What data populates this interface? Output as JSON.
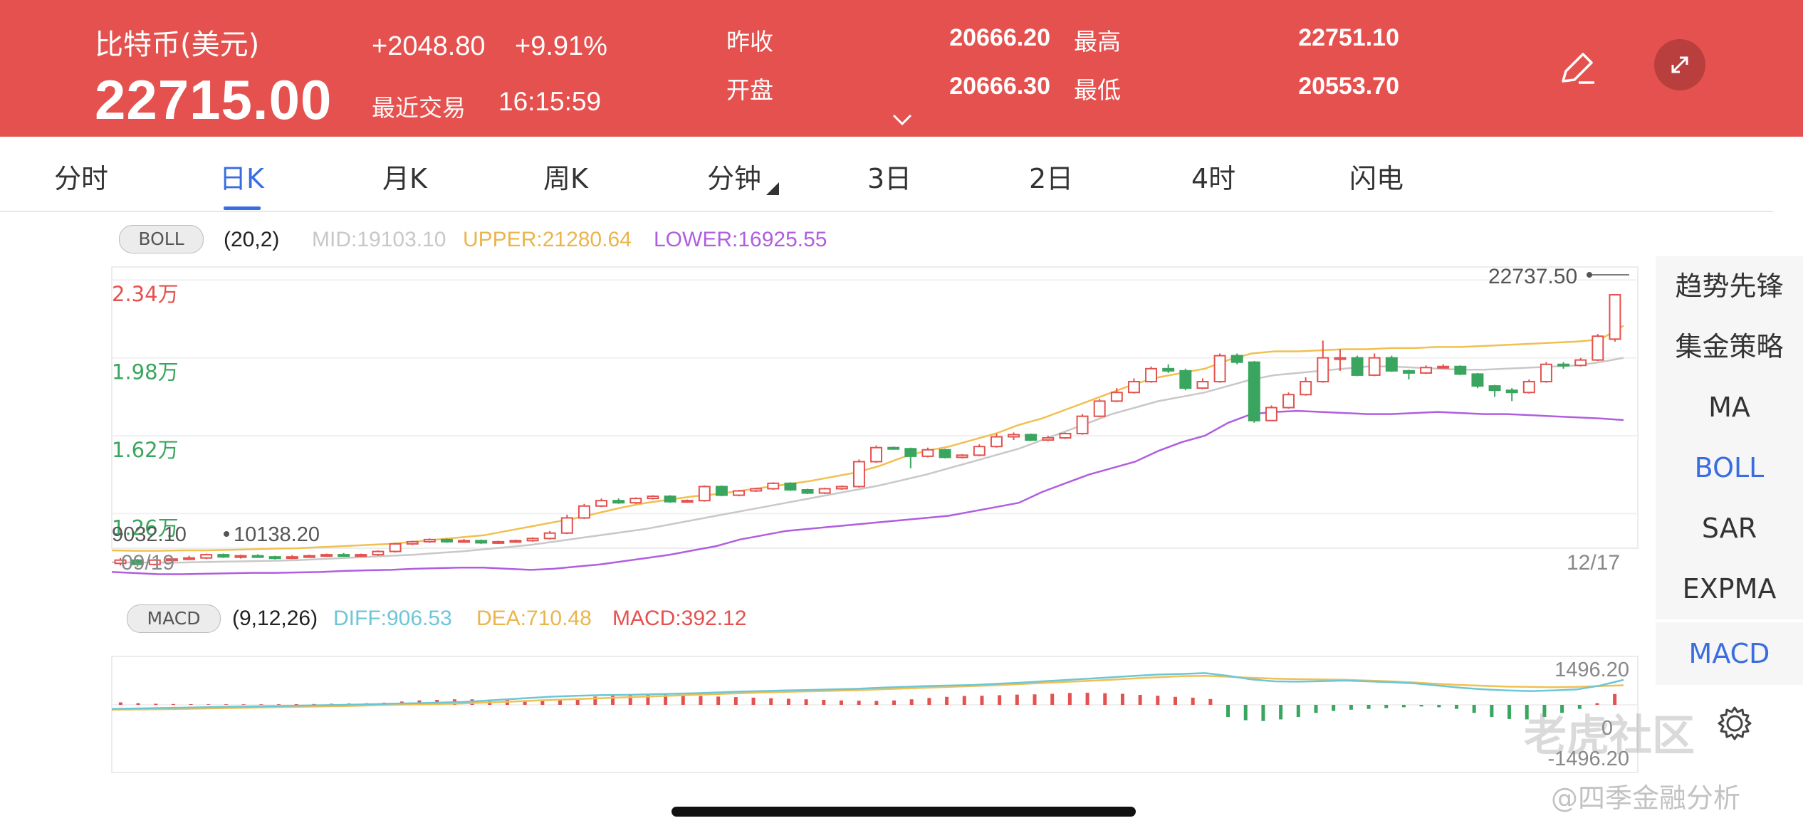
{
  "header": {
    "name": "比特币(美元)",
    "price": "22715.00",
    "change": "+2048.80",
    "change_pct": "+9.91%",
    "last_trade_label": "最近交易",
    "last_trade_time": "16:15:59",
    "prev_close_label": "昨收",
    "prev_close": "20666.20",
    "open_label": "开盘",
    "open": "20666.30",
    "high_label": "最高",
    "high": "22751.10",
    "low_label": "最低",
    "low": "20553.70"
  },
  "tabs": [
    "分时",
    "日K",
    "月K",
    "周K",
    "分钟",
    "3日",
    "2日",
    "4时",
    "闪电"
  ],
  "active_tab": "日K",
  "sidebar": [
    "趋势先锋",
    "集金策略",
    "MA",
    "BOLL",
    "SAR",
    "EXPMA"
  ],
  "sidebar_macd": "MACD",
  "boll": {
    "pill": "BOLL",
    "params": "(20,2)",
    "mid": "MID:19103.10",
    "upper": "UPPER:21280.64",
    "lower": "LOWER:16925.55"
  },
  "macd": {
    "pill": "MACD",
    "params": "(9,12,26)",
    "diff": "DIFF:906.53",
    "dea": "DEA:710.48",
    "macd": "MACD:392.12"
  },
  "watermark": "老虎社区",
  "watermark_sub": "@四季金融分析",
  "colors": {
    "up": "#e4514e",
    "down": "#3aa55e",
    "upper": "#f0c050",
    "lower": "#b05ee0",
    "mid": "#c8c8c8",
    "diff": "#6cc6d6",
    "dea": "#f0c050"
  },
  "chart_data": [
    {
      "type": "candlestick",
      "title": "",
      "x_start": "09/19",
      "x_end": "12/17",
      "y_ticks": [
        "2.34万",
        "1.98万",
        "1.62万",
        "1.26万"
      ],
      "y_tick_values": [
        23400,
        19800,
        16200,
        12600
      ],
      "ylim": [
        11000,
        24000
      ],
      "max_label": "22737.50",
      "min_label": "9032.10",
      "min_label2": "10138.20",
      "candles": [
        [
          10300,
          10450,
          10550,
          10200
        ],
        [
          10450,
          10250,
          10500,
          10150
        ],
        [
          10250,
          10450,
          10500,
          10200
        ],
        [
          10450,
          10500,
          10600,
          10380
        ],
        [
          10500,
          10550,
          10650,
          10450
        ],
        [
          10550,
          10700,
          10750,
          10500
        ],
        [
          10700,
          10600,
          10750,
          10550
        ],
        [
          10600,
          10650,
          10700,
          10520
        ],
        [
          10650,
          10600,
          10720,
          10550
        ],
        [
          10600,
          10550,
          10650,
          10480
        ],
        [
          10550,
          10600,
          10680,
          10500
        ],
        [
          10600,
          10650,
          10700,
          10560
        ],
        [
          10650,
          10700,
          10750,
          10600
        ],
        [
          10700,
          10650,
          10780,
          10620
        ],
        [
          10650,
          10700,
          10750,
          10600
        ],
        [
          10700,
          10850,
          10900,
          10650
        ],
        [
          10850,
          11200,
          11250,
          10800
        ],
        [
          11200,
          11300,
          11350,
          11150
        ],
        [
          11300,
          11400,
          11450,
          11250
        ],
        [
          11400,
          11300,
          11450,
          11250
        ],
        [
          11300,
          11350,
          11420,
          11250
        ],
        [
          11350,
          11250,
          11400,
          11200
        ],
        [
          11250,
          11300,
          11350,
          11200
        ],
        [
          11300,
          11350,
          11400,
          11250
        ],
        [
          11350,
          11450,
          11500,
          11300
        ],
        [
          11450,
          11700,
          11800,
          11400
        ],
        [
          11700,
          12400,
          12550,
          11650
        ],
        [
          12400,
          12950,
          13050,
          12350
        ],
        [
          12950,
          13200,
          13300,
          12900
        ],
        [
          13200,
          13100,
          13300,
          13050
        ],
        [
          13100,
          13300,
          13350,
          13050
        ],
        [
          13300,
          13400,
          13450,
          13250
        ],
        [
          13400,
          13150,
          13450,
          13100
        ],
        [
          13150,
          13200,
          13250,
          13100
        ],
        [
          13200,
          13850,
          13900,
          13150
        ],
        [
          13850,
          13450,
          13900,
          13400
        ],
        [
          13450,
          13650,
          13700,
          13400
        ],
        [
          13650,
          13750,
          13800,
          13600
        ],
        [
          13750,
          14000,
          14050,
          13700
        ],
        [
          14000,
          13700,
          14050,
          13650
        ],
        [
          13700,
          13550,
          13750,
          13500
        ],
        [
          13550,
          13750,
          13800,
          13500
        ],
        [
          13750,
          13850,
          13900,
          13700
        ],
        [
          13850,
          15000,
          15100,
          13800
        ],
        [
          15000,
          15650,
          15750,
          14950
        ],
        [
          15650,
          15600,
          15700,
          15550
        ],
        [
          15600,
          15250,
          15650,
          14700
        ],
        [
          15250,
          15550,
          15650,
          15200
        ],
        [
          15550,
          15200,
          15600,
          15150
        ],
        [
          15200,
          15300,
          15350,
          15150
        ],
        [
          15300,
          15700,
          15800,
          15250
        ],
        [
          15700,
          16150,
          16300,
          15650
        ],
        [
          16150,
          16250,
          16350,
          16000
        ],
        [
          16250,
          16000,
          16300,
          15950
        ],
        [
          16000,
          16100,
          16200,
          15950
        ],
        [
          16100,
          16300,
          16350,
          16050
        ],
        [
          16300,
          17100,
          17200,
          16250
        ],
        [
          17100,
          17800,
          17900,
          17050
        ],
        [
          17800,
          18200,
          18400,
          17750
        ],
        [
          18200,
          18700,
          18850,
          18150
        ],
        [
          18700,
          19300,
          19400,
          18650
        ],
        [
          19300,
          19200,
          19500,
          19100
        ],
        [
          19200,
          18400,
          19300,
          18300
        ],
        [
          18400,
          18700,
          18850,
          18350
        ],
        [
          18700,
          19900,
          20000,
          18650
        ],
        [
          19900,
          19600,
          20000,
          19500
        ],
        [
          19600,
          16900,
          19650,
          16800
        ],
        [
          16900,
          17500,
          17600,
          17300
        ],
        [
          17500,
          18100,
          18200,
          17450
        ],
        [
          18100,
          18700,
          18900,
          18050
        ],
        [
          18700,
          19800,
          20600,
          18650
        ],
        [
          19800,
          19800,
          20200,
          19200
        ],
        [
          19800,
          19000,
          19900,
          18950
        ],
        [
          19000,
          19800,
          20000,
          18950
        ],
        [
          19800,
          19200,
          19900,
          19150
        ],
        [
          19200,
          19100,
          19250,
          18800
        ],
        [
          19100,
          19350,
          19450,
          19050
        ],
        [
          19350,
          19400,
          19500,
          19300
        ],
        [
          19400,
          19050,
          19450,
          19000
        ],
        [
          19050,
          18500,
          19100,
          18400
        ],
        [
          18500,
          18300,
          18550,
          18000
        ],
        [
          18300,
          18200,
          18400,
          17800
        ],
        [
          18200,
          18700,
          18800,
          18150
        ],
        [
          18700,
          19500,
          19600,
          18650
        ],
        [
          19500,
          19450,
          19600,
          19300
        ],
        [
          19450,
          19700,
          19800,
          19400
        ],
        [
          19700,
          20800,
          20900,
          19650
        ],
        [
          20666,
          22715,
          22751,
          20553
        ]
      ],
      "upper": [
        10900,
        10880,
        10880,
        10900,
        10900,
        10920,
        10950,
        10980,
        11000,
        11050,
        11100,
        11150,
        11200,
        11300,
        11400,
        11500,
        11600,
        11800,
        12000,
        12200,
        12400,
        12650,
        12900,
        13100,
        13250,
        13400,
        13500,
        13650,
        13800,
        13950,
        14100,
        14300,
        14500,
        14800,
        15200,
        15500,
        15700,
        16000,
        16300,
        16700,
        17000,
        17400,
        17800,
        18200,
        18600,
        18900,
        19100,
        19300,
        19700,
        20000,
        20100,
        20100,
        20150,
        20200,
        20200,
        20250,
        20250,
        20300,
        20300,
        20350,
        20400,
        20450,
        20500,
        20550,
        20650,
        21280
      ],
      "mid": [
        10350,
        10340,
        10340,
        10340,
        10360,
        10380,
        10400,
        10420,
        10450,
        10500,
        10550,
        10600,
        10650,
        10700,
        10780,
        10850,
        10950,
        11050,
        11150,
        11300,
        11450,
        11600,
        11750,
        11900,
        12100,
        12300,
        12500,
        12700,
        12900,
        13100,
        13300,
        13500,
        13700,
        13900,
        14150,
        14400,
        14700,
        15000,
        15300,
        15600,
        16000,
        16400,
        16800,
        17200,
        17500,
        17800,
        18000,
        18200,
        18500,
        18800,
        19000,
        19100,
        19200,
        19300,
        19400,
        19400,
        19350,
        19300,
        19250,
        19250,
        19300,
        19350,
        19400,
        19450,
        19600,
        19800
      ],
      "lower": [
        9900,
        9850,
        9800,
        9800,
        9820,
        9840,
        9860,
        9860,
        9880,
        9900,
        9950,
        9980,
        10000,
        10050,
        10080,
        10100,
        10100,
        10050,
        10000,
        10050,
        10150,
        10250,
        10400,
        10550,
        10700,
        10900,
        11100,
        11400,
        11600,
        11800,
        11900,
        12000,
        12100,
        12200,
        12300,
        12400,
        12500,
        12700,
        12900,
        13100,
        13600,
        14000,
        14400,
        14700,
        15000,
        15500,
        15900,
        16200,
        16800,
        17200,
        17300,
        17350,
        17300,
        17250,
        17200,
        17200,
        17250,
        17300,
        17250,
        17200,
        17200,
        17150,
        17100,
        17050,
        17000,
        16925
      ]
    },
    {
      "type": "macd",
      "title": "",
      "ylim": [
        -1496.2,
        1496.2
      ],
      "y_ticks": [
        "1496.20",
        "0",
        "-1496.20"
      ],
      "hist": [
        90,
        60,
        40,
        30,
        25,
        20,
        20,
        20,
        20,
        20,
        25,
        30,
        40,
        50,
        60,
        80,
        120,
        160,
        180,
        200,
        200,
        190,
        180,
        170,
        160,
        170,
        220,
        300,
        330,
        360,
        370,
        380,
        350,
        320,
        300,
        280,
        260,
        240,
        220,
        200,
        180,
        160,
        150,
        140,
        160,
        200,
        250,
        290,
        320,
        330,
        350,
        370,
        380,
        400,
        430,
        440,
        420,
        400,
        360,
        330,
        290,
        260,
        210,
        -300,
        -380,
        -400,
        -360,
        -300,
        -200,
        -150,
        -120,
        -100,
        -80,
        -60,
        -40,
        -60,
        -100,
        -200,
        -300,
        -350,
        -360,
        -300,
        -200,
        -100,
        60,
        392
      ],
      "diff": [
        -100,
        -90,
        -80,
        -70,
        -60,
        -50,
        -40,
        -30,
        -20,
        -10,
        0,
        20,
        40,
        60,
        80,
        100,
        150,
        200,
        250,
        300,
        330,
        350,
        360,
        380,
        400,
        420,
        450,
        480,
        500,
        520,
        540,
        560,
        580,
        620,
        650,
        680,
        700,
        720,
        760,
        800,
        850,
        900,
        950,
        1000,
        1050,
        1100,
        1120,
        1150,
        1050,
        920,
        850,
        840,
        860,
        880,
        850,
        820,
        780,
        700,
        620,
        560,
        520,
        500,
        520,
        560,
        700,
        906
      ],
      "dea": [
        -120,
        -115,
        -110,
        -100,
        -90,
        -80,
        -70,
        -60,
        -50,
        -40,
        -30,
        -15,
        0,
        15,
        30,
        50,
        80,
        110,
        150,
        180,
        210,
        240,
        270,
        300,
        330,
        360,
        390,
        420,
        450,
        470,
        490,
        510,
        530,
        560,
        590,
        620,
        650,
        680,
        710,
        750,
        790,
        830,
        870,
        910,
        960,
        1000,
        1040,
        1050,
        1020,
        980,
        950,
        930,
        920,
        910,
        880,
        850,
        810,
        760,
        720,
        690,
        660,
        650,
        640,
        650,
        680,
        710
      ]
    }
  ]
}
